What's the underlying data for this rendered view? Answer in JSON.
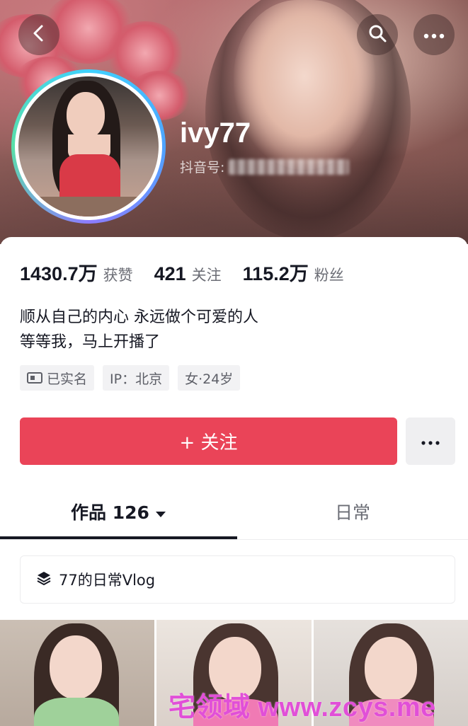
{
  "header": {
    "back_icon": "chevron-left-icon",
    "search_icon": "search-icon",
    "more_icon": "ellipsis-icon"
  },
  "profile": {
    "username": "ivy77",
    "douyin_id_label": "抖音号:"
  },
  "stats": [
    {
      "value": "1430.7万",
      "label": "获赞"
    },
    {
      "value": "421",
      "label": "关注"
    },
    {
      "value": "115.2万",
      "label": "粉丝"
    }
  ],
  "bio": {
    "line1": "顺从自己的内心 永远做个可爱的人",
    "line2": "等等我，马上开播了"
  },
  "tags": [
    {
      "label": "已实名",
      "icon": "id-card-icon"
    },
    {
      "label": "IP：北京"
    },
    {
      "label": "女·24岁"
    }
  ],
  "actions": {
    "follow_label": "+ 关注",
    "more_label": "···"
  },
  "tabs": [
    {
      "label": "作品 126",
      "active": true,
      "dropdown_icon": "caret-down-icon"
    },
    {
      "label": "日常",
      "active": false
    }
  ],
  "collection": {
    "label": "77的日常Vlog",
    "icon": "layers-icon"
  },
  "watermark": "宅领域 www.zcys.me",
  "colors": {
    "accent": "#ea4458",
    "watermark": "#e14fd8"
  }
}
